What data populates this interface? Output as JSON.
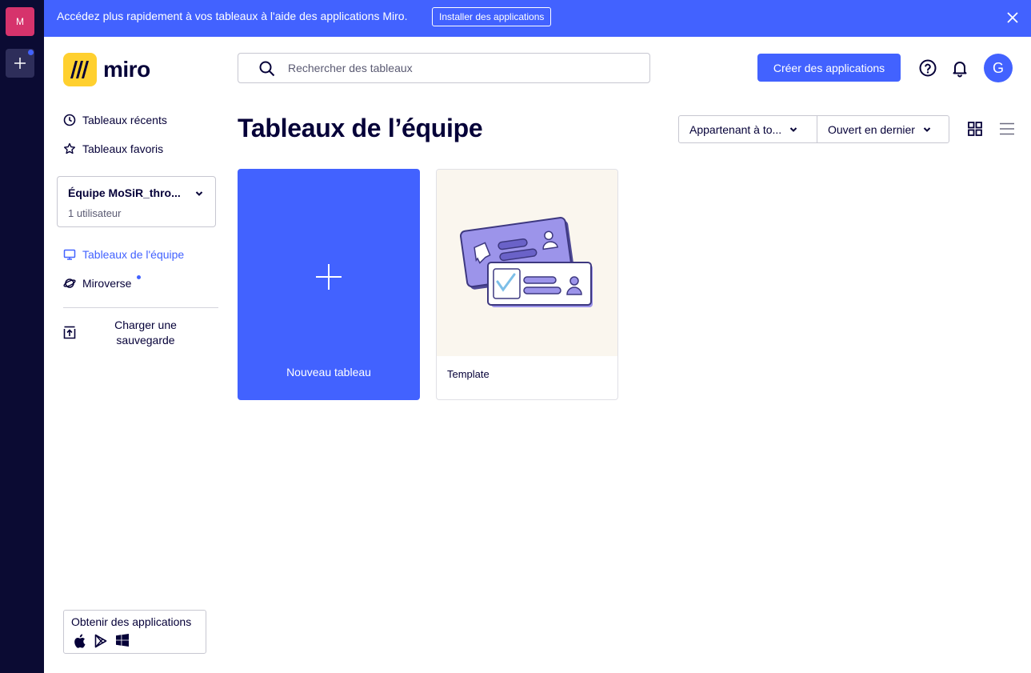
{
  "rail": {
    "team_initial": "M",
    "add_team_symbol": "+"
  },
  "banner": {
    "text": "Accédez plus rapidement à vos tableaux à l'aide des applications Miro.",
    "install_button": "Installer des applications"
  },
  "header": {
    "logo_text": "miro",
    "search_placeholder": "Rechercher des tableaux",
    "search_value": "",
    "create_apps_button": "Créer des applications",
    "user_initial": "G"
  },
  "sidebar": {
    "recent": "Tableaux récents",
    "favorites": "Tableaux favoris",
    "team": {
      "name": "Équipe MoSiR_thro...",
      "users": "1 utilisateur"
    },
    "team_boards": "Tableaux de l'équipe",
    "miroverse": "Miroverse",
    "upload": "Charger une sauvegarde",
    "get_apps": "Obtenir des applications"
  },
  "main": {
    "title": "Tableaux de l’équipe",
    "filter_owner": "Appartenant à to...",
    "filter_sort": "Ouvert en dernier",
    "new_board_label": "Nouveau tableau",
    "boards": [
      {
        "name": "Template"
      }
    ]
  },
  "colors": {
    "accent": "#4262ff",
    "rail": "#0b0b33",
    "team_avatar": "#d6336c",
    "text": "#050038"
  }
}
